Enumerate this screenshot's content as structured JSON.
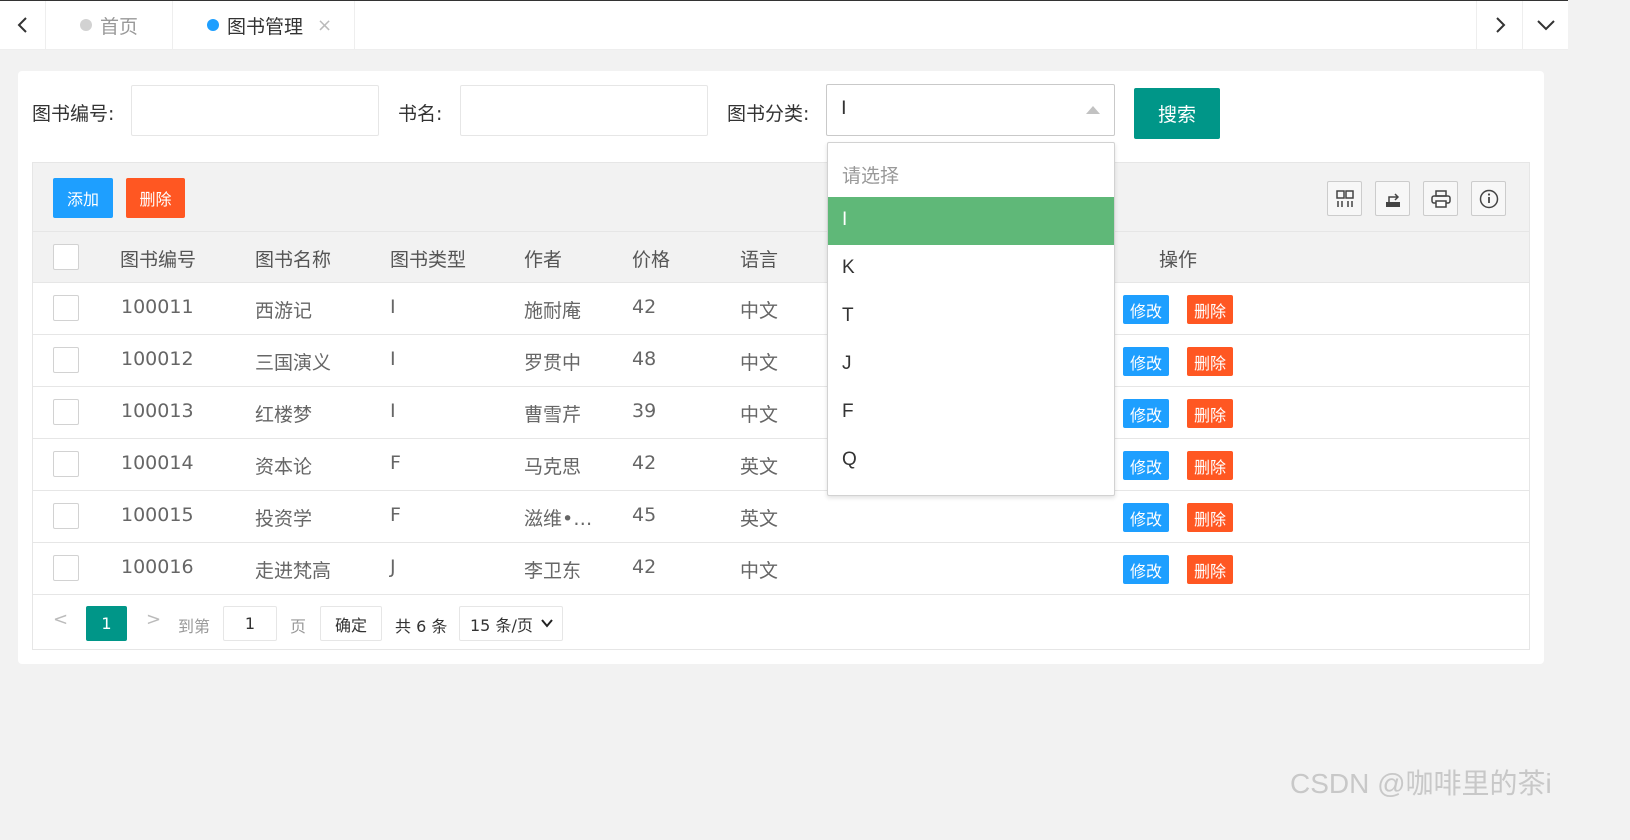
{
  "tabs": [
    {
      "label": "首页",
      "active": false
    },
    {
      "label": "图书管理",
      "active": true,
      "close": "×"
    }
  ],
  "filters": {
    "book_id_label": "图书编号:",
    "book_id_value": "",
    "name_label": "书名:",
    "name_value": "",
    "category_label": "图书分类:",
    "category_value": "I",
    "search_label": "搜索"
  },
  "dropdown": {
    "placeholder": "请选择",
    "options": [
      "I",
      "K",
      "T",
      "J",
      "F",
      "Q"
    ],
    "selected": "I"
  },
  "toolbar": {
    "add_label": "添加",
    "delete_label": "删除",
    "icons": [
      "columns-icon",
      "export-icon",
      "print-icon",
      "info-icon"
    ]
  },
  "table": {
    "headers": [
      "图书编号",
      "图书名称",
      "图书类型",
      "作者",
      "价格",
      "语言",
      "操作"
    ],
    "rows": [
      {
        "id": "100011",
        "name": "西游记",
        "type": "I",
        "author": "施耐庵",
        "price": "42",
        "lang": "中文"
      },
      {
        "id": "100012",
        "name": "三国演义",
        "type": "I",
        "author": "罗贯中",
        "price": "48",
        "lang": "中文"
      },
      {
        "id": "100013",
        "name": "红楼梦",
        "type": "I",
        "author": "曹雪芹",
        "price": "39",
        "lang": "中文"
      },
      {
        "id": "100014",
        "name": "资本论",
        "type": "F",
        "author": "马克思",
        "price": "42",
        "lang": "英文"
      },
      {
        "id": "100015",
        "name": "投资学",
        "type": "F",
        "author": "滋维•…",
        "price": "45",
        "lang": "英文"
      },
      {
        "id": "100016",
        "name": "走进梵高",
        "type": "J",
        "author": "李卫东",
        "price": "42",
        "lang": "中文"
      }
    ],
    "edit_label": "修改",
    "row_delete_label": "删除"
  },
  "pager": {
    "prev": "<",
    "current": "1",
    "next": ">",
    "goto_label": "到第",
    "goto_value": "1",
    "page_label": "页",
    "confirm_label": "确定",
    "total_label": "共 6 条",
    "page_size": "15 条/页"
  },
  "watermark": "CSDN @咖啡里的茶i",
  "colors": {
    "primary": "#009688",
    "blue": "#1e9fff",
    "danger": "#ff5722",
    "selected": "#5fb878"
  }
}
